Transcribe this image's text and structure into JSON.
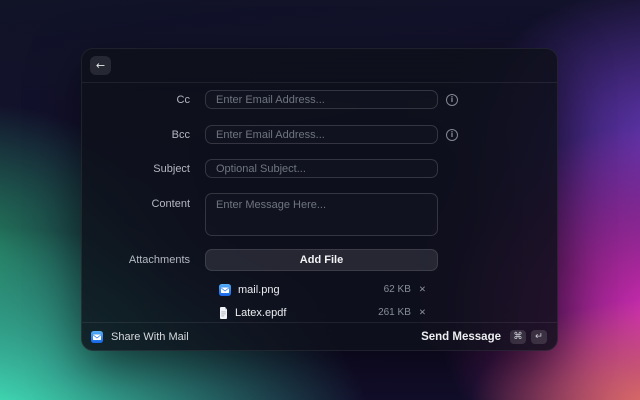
{
  "window": {
    "header": {
      "back_icon_glyph": "←"
    },
    "form": {
      "rows": [
        {
          "label": "Cc",
          "placeholder": "Enter Email Address...",
          "value": "",
          "type": "input"
        },
        {
          "label": "Bcc",
          "placeholder": "Enter Email Address...",
          "value": "",
          "type": "input"
        },
        {
          "label": "Subject",
          "placeholder": "Optional Subject...",
          "value": "",
          "type": "input"
        },
        {
          "label": "Content",
          "placeholder": "Enter Message Here...",
          "value": "",
          "type": "textarea"
        }
      ],
      "attachments": {
        "label": "Attachments",
        "add_file_label": "Add File",
        "files": [
          {
            "name": "mail.png",
            "size": "62 KB",
            "icon": "mail-app-icon"
          },
          {
            "name": "Latex.epdf",
            "size": "261 KB",
            "icon": "document-icon"
          }
        ]
      }
    },
    "footer": {
      "app_label": "Share With Mail",
      "action_label": "Send Message",
      "shortcuts": [
        "⌘",
        "↵"
      ]
    }
  },
  "icons": {
    "info": "i",
    "close": "✕"
  },
  "colors": {
    "mail_icon_blue_top": "#59b0f8",
    "mail_icon_blue_bottom": "#1565e8",
    "bg_teal": "#46f5c6",
    "bg_green": "#289e6c",
    "bg_purple": "#6e3cc6",
    "bg_magenta": "#de2ebe",
    "bg_salmon": "#eb7864",
    "panel_bg": "#0d1019"
  }
}
